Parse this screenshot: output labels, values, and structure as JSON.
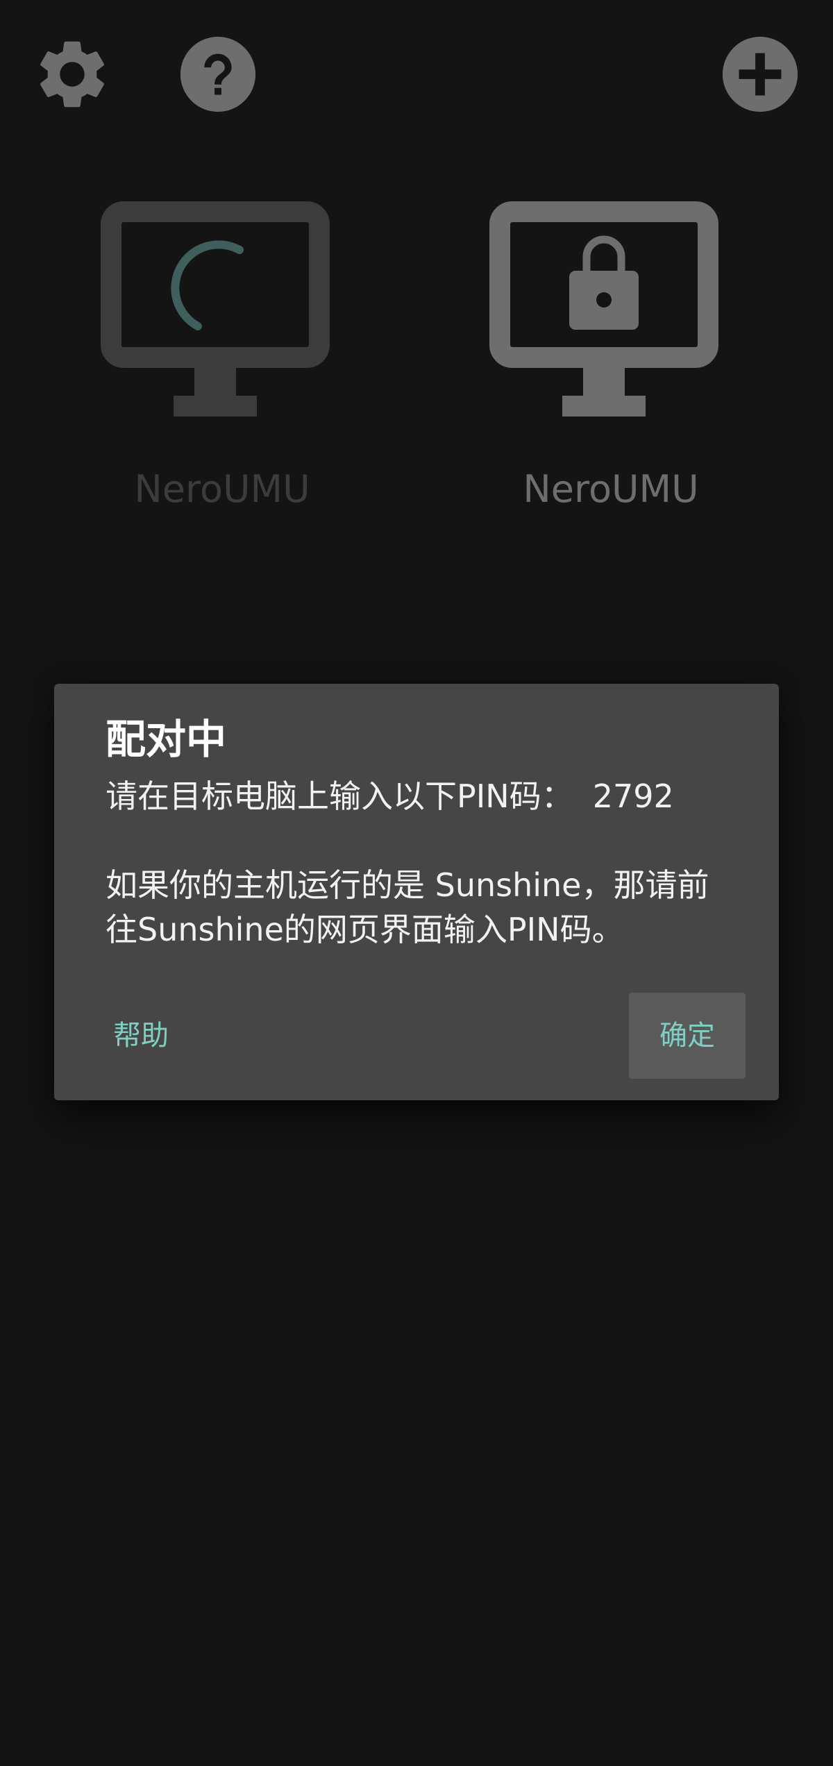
{
  "toolbar": {
    "settings_icon": "gear-icon",
    "help_icon": "question-circle-icon",
    "add_icon": "plus-circle-icon"
  },
  "pc_list": [
    {
      "name": "NeroUMU",
      "state": "loading",
      "icon": "monitor-spinner-icon"
    },
    {
      "name": "NeroUMU",
      "state": "locked",
      "icon": "monitor-lock-icon"
    }
  ],
  "dialog": {
    "title": "配对中",
    "message_line_1_prefix": "请在目标电脑上输入以下PIN码：",
    "pin": "2792",
    "message_line_2": "如果你的主机运行的是 Sunshine，那请前",
    "message_line_3": "往Sunshine的网页界面输入PIN码。",
    "help_label": "帮助",
    "ok_label": "确定"
  },
  "colors": {
    "background": "#141414",
    "dialog_background": "#464646",
    "accent": "#7fcfc2",
    "icon_gray": "#6e6e6e",
    "spinner": "#3f5f5c"
  }
}
